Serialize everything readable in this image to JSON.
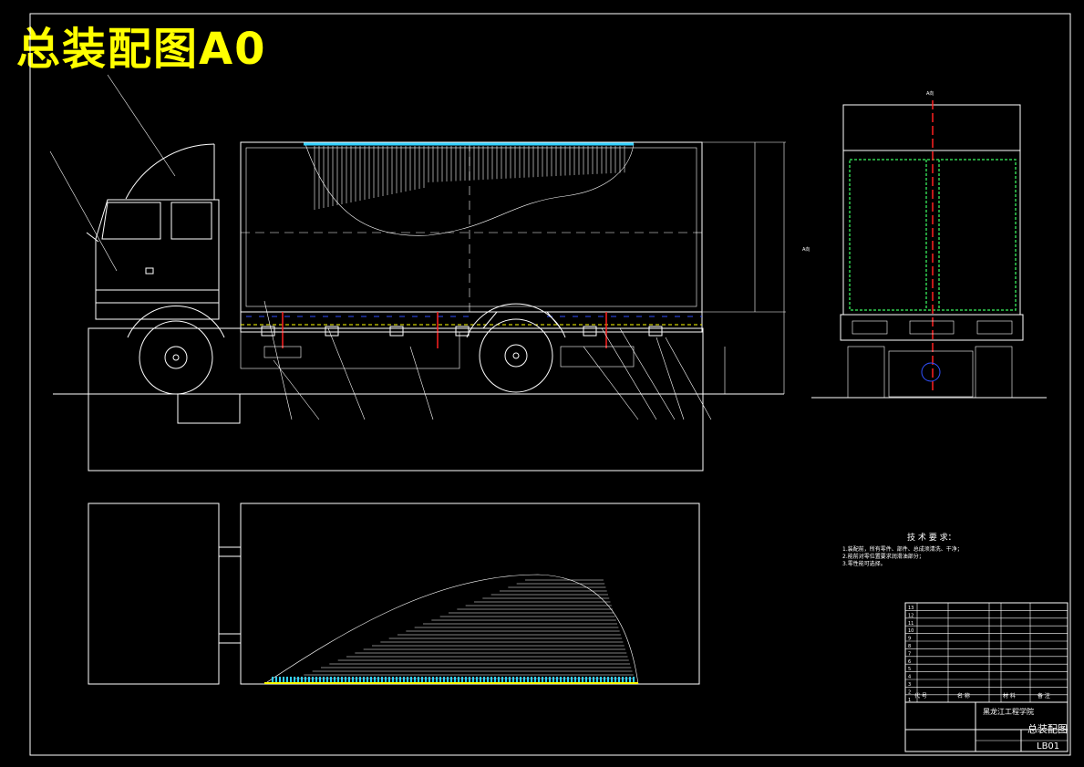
{
  "drawing": {
    "title": "总装配图A0"
  },
  "tech_requirements": {
    "heading": "技 术 要 求：",
    "items": [
      "1.装配前，所有零件、部件、总成须清洗、干净；",
      "2.能前对零位置要求润滑油部分；",
      "3.零性能可选择。"
    ]
  },
  "title_block": {
    "company": "黑龙江工程学院",
    "drawing_name": "总装配图",
    "drawing_number": "LB01",
    "header_code": "代 号",
    "header_name": "名 称",
    "header_material": "材 料",
    "header_remarks": "备 注",
    "rows": [
      "13",
      "12",
      "11",
      "10",
      "9",
      "8",
      "7",
      "6",
      "5",
      "4",
      "3",
      "2",
      "1"
    ]
  },
  "views": {
    "side_view_label": "A向",
    "end_view_label": "A向"
  },
  "colors": {
    "line": "#ffffff",
    "title": "#ffff00",
    "section": "#ff2020",
    "seal": "#30d050",
    "hatch": "#33d0ff",
    "hydraulic": "#3050ff"
  }
}
